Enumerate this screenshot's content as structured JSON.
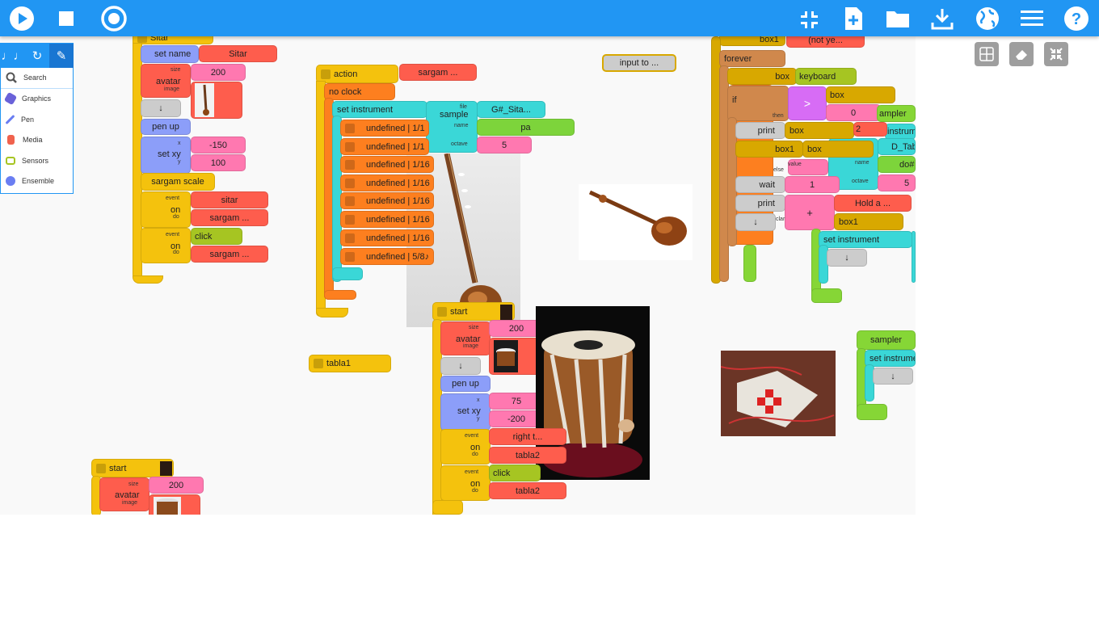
{
  "toolbar": {
    "left_icons": [
      "play-icon",
      "stop-icon",
      "record-icon"
    ],
    "right_icons": [
      "collapse-icon",
      "new-project-icon",
      "open-folder-icon",
      "save-download-icon",
      "language-globe-icon",
      "menu-icon",
      "help-icon"
    ]
  },
  "palette": {
    "tabs": [
      "music-notes-icon",
      "rhythm-icon",
      "flow-icon",
      "artwork-pen-icon"
    ],
    "search": "Search",
    "items": [
      {
        "label": "Graphics",
        "color": "#6a62d9"
      },
      {
        "label": "Pen",
        "color": "#6a7ef2"
      },
      {
        "label": "Media",
        "color": "#f0624d"
      },
      {
        "label": "Sensors",
        "color": "#a6c522"
      },
      {
        "label": "Ensemble",
        "color": "#6a7ef2"
      }
    ]
  },
  "right_tools": [
    "grid-icon",
    "clear-eraser-icon",
    "collapse-blocks-icon"
  ],
  "stack_sitar": {
    "top": "Sitar",
    "set_name": "set name",
    "name_value": "Sitar",
    "avatar": "avatar",
    "size_lbl": "size",
    "size_value": "200",
    "image_lbl": "image",
    "arrow": "↓",
    "pen_up": "pen up",
    "set_xy": "set xy",
    "x_lbl": "x",
    "y_lbl": "y",
    "x_value": "-150",
    "y_value": "100",
    "sargam_scale": "sargam scale",
    "on": "on",
    "event_lbl": "event",
    "do_lbl": "do",
    "ev1": "sitar",
    "do1": "sargam ...",
    "ev2": "click",
    "do2": "sargam ..."
  },
  "stack_action": {
    "action": "action",
    "action_name": "sargam ...",
    "no_clock": "no clock",
    "set_instrument": "set instrument",
    "sample": "sample",
    "file_lbl": "file",
    "name_lbl": "name",
    "octave_lbl": "octave",
    "file_value": "G#_Sita...",
    "name_value": "pa",
    "octave_value": "5",
    "notes": [
      "undefined | 1/1",
      "undefined | 1/1",
      "undefined | 1/16",
      "undefined | 1/16",
      "undefined | 1/16",
      "undefined | 1/16",
      "undefined | 1/16",
      "undefined | 5/8♪"
    ]
  },
  "input_to": "input to ...",
  "tabla1": "tabla1",
  "stack_start": {
    "start": "start",
    "avatar": "avatar",
    "size_lbl": "size",
    "size_value": "200",
    "image_lbl": "image",
    "arrow": "↓",
    "pen_up": "pen up",
    "set_xy": "set xy",
    "x_lbl": "x",
    "y_lbl": "y",
    "x_value": "75",
    "y_value": "-200",
    "on": "on",
    "event_lbl": "event",
    "do_lbl": "do",
    "ev1": "right t...",
    "do1": "tabla2",
    "ev2": "click",
    "do2": "tabla2"
  },
  "stack_start2": {
    "start": "start",
    "avatar": "avatar",
    "size_lbl": "size",
    "size_value": "200",
    "image_lbl": "image"
  },
  "stack_forever": {
    "box1_top": "box1",
    "box1_top_val": "(not ye...",
    "forever": "forever",
    "box": "box",
    "keyboard": "keyboard",
    "if": "if",
    "then": "then",
    "else": "else",
    "gt": ">",
    "box_r": "box",
    "zero": "0",
    "print": "print",
    "print_val": "box",
    "box1": "box1",
    "box1_val": "box",
    "wait": "wait",
    "wait_val": "1",
    "print2": "print",
    "plus": "+",
    "hold": "Hold a ...",
    "box1_r": "box1",
    "arrow": "↓",
    "sampler_p": "ampler",
    "instru_p": "instrum",
    "d_tab_p": "D_Tab",
    "do_p": "do#",
    "five_p": "5",
    "two_p": "2",
    "value_lbl": "value",
    "name_lbl": "name",
    "octave_lbl": "octave",
    "set_instrument": "set instrument",
    "clap_p": "clar"
  },
  "sampler_block": {
    "sampler": "sampler",
    "set_instrument": "set instrume",
    "arrow": "↓"
  }
}
